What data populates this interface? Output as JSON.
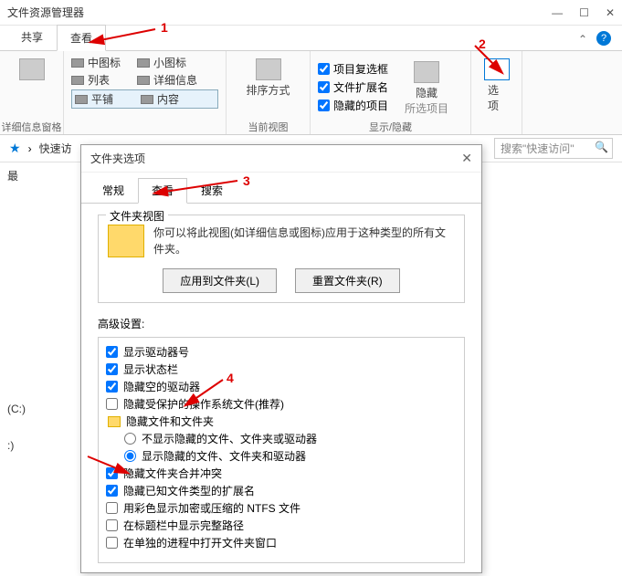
{
  "window": {
    "title": "文件资源管理器"
  },
  "tabs": {
    "share": "共享",
    "view": "查看"
  },
  "ribbon": {
    "group1": {
      "label": "详细信息窗格",
      "items": [
        "中图标",
        "小图标",
        "列表",
        "详细信息",
        "平铺",
        "内容"
      ]
    },
    "group2": {
      "sort": "排序方式",
      "label": "当前视图"
    },
    "group3": {
      "checkboxes": [
        "项目复选框",
        "文件扩展名",
        "隐藏的项目"
      ],
      "hide": "隐藏",
      "hide_sub": "所选项目",
      "label": "显示/隐藏"
    },
    "options": "选项"
  },
  "breadcrumb": {
    "text": "快速访",
    "search_placeholder": "搜索\"快速访问\""
  },
  "sidebar": {
    "item1": "最",
    "item2": "(C:)",
    "item3": ":)"
  },
  "dialog": {
    "title": "文件夹选项",
    "tabs": {
      "general": "常规",
      "view": "查看",
      "search": "搜索"
    },
    "folder_view": {
      "title": "文件夹视图",
      "desc": "你可以将此视图(如详细信息或图标)应用于这种类型的所有文件夹。",
      "apply_btn": "应用到文件夹(L)",
      "reset_btn": "重置文件夹(R)"
    },
    "advanced": {
      "label": "高级设置:",
      "items": [
        {
          "type": "checkbox",
          "checked": true,
          "label": "显示驱动器号"
        },
        {
          "type": "checkbox",
          "checked": true,
          "label": "显示状态栏"
        },
        {
          "type": "checkbox",
          "checked": true,
          "label": "隐藏空的驱动器"
        },
        {
          "type": "checkbox",
          "checked": false,
          "label": "隐藏受保护的操作系统文件(推荐)"
        },
        {
          "type": "folder",
          "label": "隐藏文件和文件夹"
        },
        {
          "type": "radio",
          "checked": false,
          "label": "不显示隐藏的文件、文件夹或驱动器",
          "indent": true
        },
        {
          "type": "radio",
          "checked": true,
          "label": "显示隐藏的文件、文件夹和驱动器",
          "indent": true
        },
        {
          "type": "checkbox",
          "checked": true,
          "label": "隐藏文件夹合并冲突"
        },
        {
          "type": "checkbox",
          "checked": true,
          "label": "隐藏已知文件类型的扩展名"
        },
        {
          "type": "checkbox",
          "checked": false,
          "label": "用彩色显示加密或压缩的 NTFS 文件"
        },
        {
          "type": "checkbox",
          "checked": false,
          "label": "在标题栏中显示完整路径"
        },
        {
          "type": "checkbox",
          "checked": false,
          "label": "在单独的进程中打开文件夹窗口"
        }
      ]
    }
  },
  "annotations": {
    "a1": "1",
    "a2": "2",
    "a3": "3",
    "a4": "4"
  }
}
